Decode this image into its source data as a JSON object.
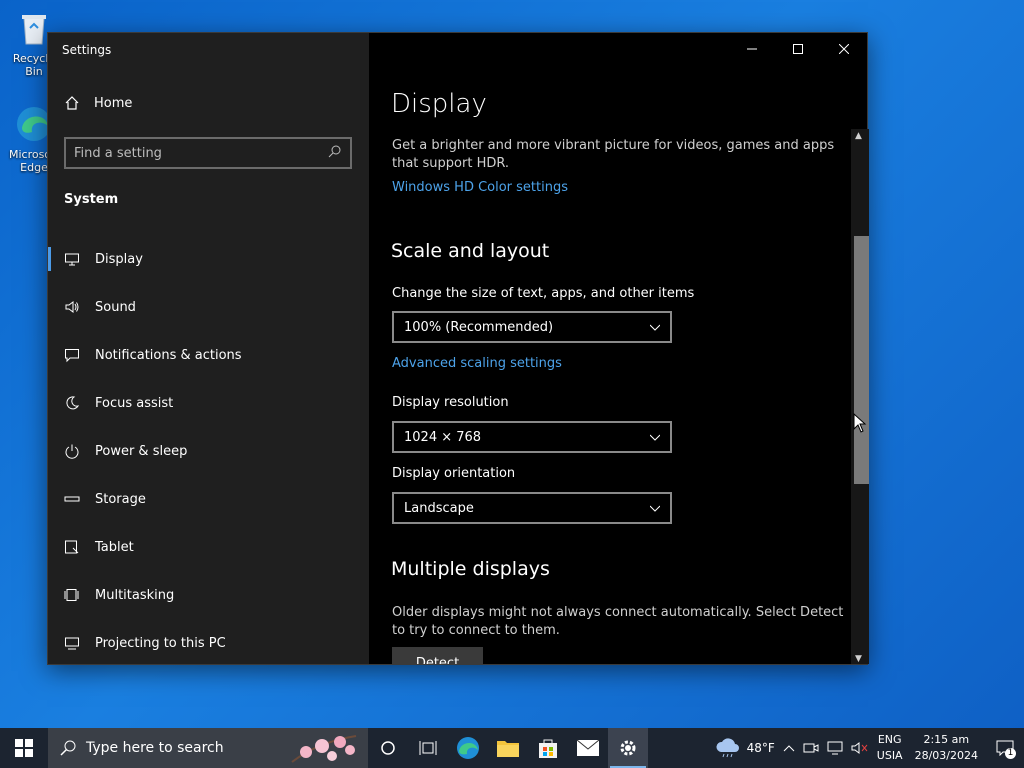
{
  "desktop": {
    "icons": [
      {
        "label": "Recycle Bin",
        "icon": "recycle-bin-icon"
      },
      {
        "label": "Microsoft Edge",
        "icon": "edge-icon"
      }
    ]
  },
  "window": {
    "title": "Settings",
    "controls": [
      "minimize",
      "maximize",
      "close"
    ]
  },
  "sidebar": {
    "home_label": "Home",
    "search_placeholder": "Find a setting",
    "section": "System",
    "items": [
      {
        "label": "Display",
        "icon": "monitor-icon",
        "active": true
      },
      {
        "label": "Sound",
        "icon": "speaker-icon"
      },
      {
        "label": "Notifications & actions",
        "icon": "notification-icon"
      },
      {
        "label": "Focus assist",
        "icon": "moon-icon"
      },
      {
        "label": "Power & sleep",
        "icon": "power-icon"
      },
      {
        "label": "Storage",
        "icon": "storage-icon"
      },
      {
        "label": "Tablet",
        "icon": "tablet-icon"
      },
      {
        "label": "Multitasking",
        "icon": "multitasking-icon"
      },
      {
        "label": "Projecting to this PC",
        "icon": "projecting-icon"
      }
    ]
  },
  "content": {
    "title": "Display",
    "hdr_description": "Get a brighter and more vibrant picture for videos, games and apps that support HDR.",
    "hdr_link": "Windows HD Color settings",
    "scale_heading": "Scale and layout",
    "scale_label": "Change the size of text, apps, and other items",
    "scale_value": "100% (Recommended)",
    "advanced_link": "Advanced scaling settings",
    "resolution_label": "Display resolution",
    "resolution_value": "1024 × 768",
    "orientation_label": "Display orientation",
    "orientation_value": "Landscape",
    "multi_heading": "Multiple displays",
    "multi_description": "Older displays might not always connect automatically. Select Detect to try to connect to them.",
    "detect_button": "Detect"
  },
  "taskbar": {
    "search_placeholder": "Type here to search",
    "apps": [
      "cortana-icon",
      "task-view-icon",
      "edge-icon",
      "file-explorer-icon",
      "store-icon",
      "mail-icon",
      "settings-icon"
    ],
    "weather": "48°F",
    "language_top": "ENG",
    "language_bottom": "USIA",
    "time": "2:15 am",
    "date": "28/03/2024",
    "notification_count": "1"
  },
  "colors": {
    "accent": "#4da3ea",
    "sidebar_bg": "#1f1f1f",
    "content_bg": "#000000",
    "desktop_blue": "#0a63c9"
  }
}
